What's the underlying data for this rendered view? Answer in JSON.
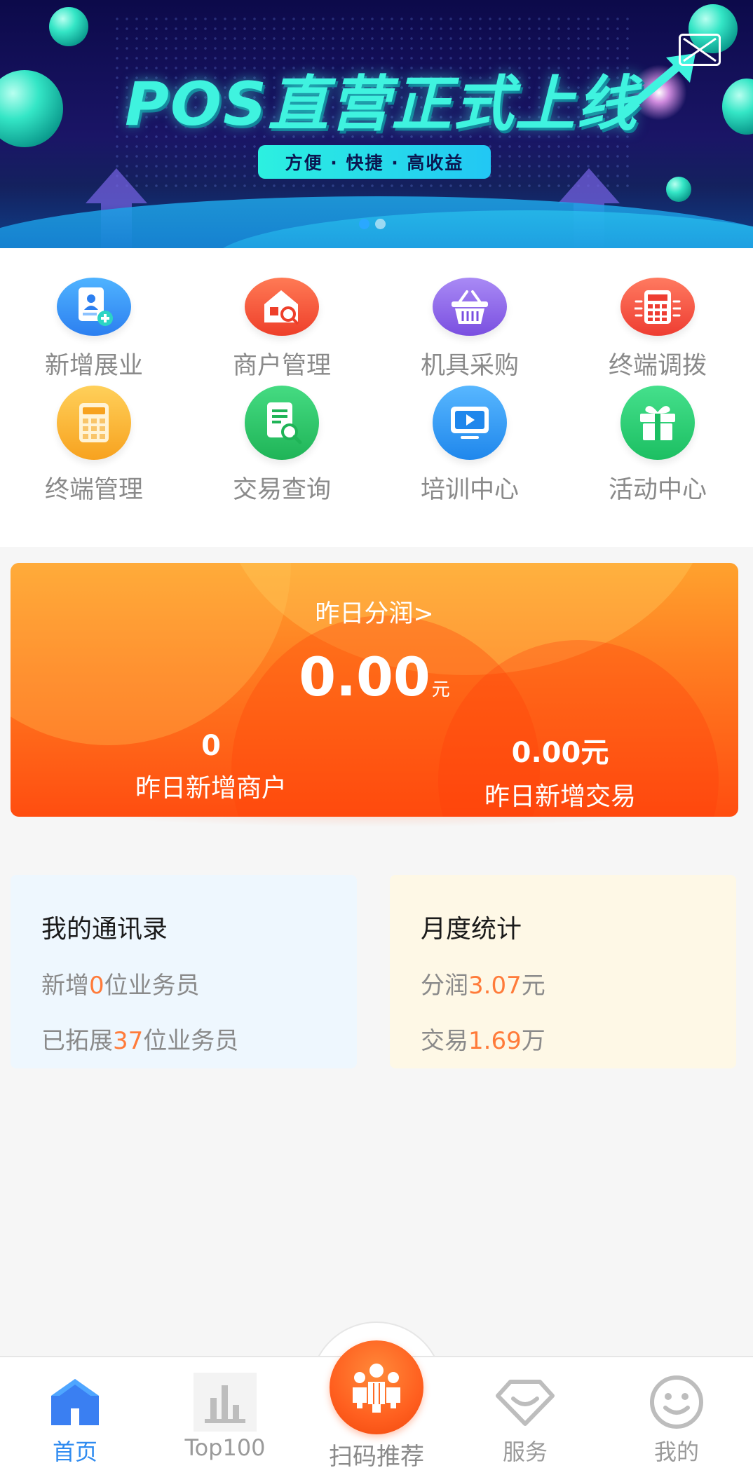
{
  "banner": {
    "headline": "POS直营正式上线",
    "subtitle": "方便 · 快捷 · 高收益",
    "dots": 2,
    "active_dot": 1,
    "close_icon": "close-icon"
  },
  "menu": {
    "items": [
      {
        "label": "新增展业",
        "icon": "add-contact-icon",
        "color": "#3a9cf5"
      },
      {
        "label": "商户管理",
        "icon": "store-search-icon",
        "color": "#f35a3c"
      },
      {
        "label": "机具采购",
        "icon": "basket-icon",
        "color": "#8f66e8"
      },
      {
        "label": "终端调拨",
        "icon": "calculator-icon",
        "color": "#f55a46"
      },
      {
        "label": "终端管理",
        "icon": "calculator-icon",
        "color": "#fbb532"
      },
      {
        "label": "交易查询",
        "icon": "document-search-icon",
        "color": "#2fc668"
      },
      {
        "label": "培训中心",
        "icon": "video-icon",
        "color": "#2f9cf2"
      },
      {
        "label": "活动中心",
        "icon": "gift-icon",
        "color": "#2fd07a"
      }
    ]
  },
  "profit": {
    "title": "昨日分润>",
    "value": "0.00",
    "unit": "元",
    "stats": [
      {
        "value": "0",
        "label": "昨日新增商户"
      },
      {
        "value": "0.00元",
        "label": "昨日新增交易"
      }
    ]
  },
  "contacts": {
    "title": "我的通讯录",
    "line1_prefix": "新增",
    "line1_value": "0",
    "line1_suffix": "位业务员",
    "line2_prefix": "已拓展",
    "line2_value": "37",
    "line2_suffix": "位业务员"
  },
  "monthly": {
    "title": "月度统计",
    "line1_prefix": "分润",
    "line1_value": "3.07",
    "line1_suffix": "元",
    "line2_prefix": "交易",
    "line2_value": "1.69",
    "line2_suffix": "万"
  },
  "tabbar": {
    "tabs": [
      {
        "label": "首页",
        "icon": "home-icon",
        "active": true
      },
      {
        "label": "Top100",
        "icon": "bar-chart-icon",
        "active": false
      },
      {
        "label": "扫码推荐",
        "icon": "people-icon",
        "active": false
      },
      {
        "label": "服务",
        "icon": "diamond-icon",
        "active": false
      },
      {
        "label": "我的",
        "icon": "smiley-icon",
        "active": false
      }
    ]
  },
  "colors": {
    "accent": "#2f8bf0",
    "highlight": "#ff7b3a",
    "profit_top": "#ffa22e",
    "profit_bottom": "#ff4d10"
  }
}
